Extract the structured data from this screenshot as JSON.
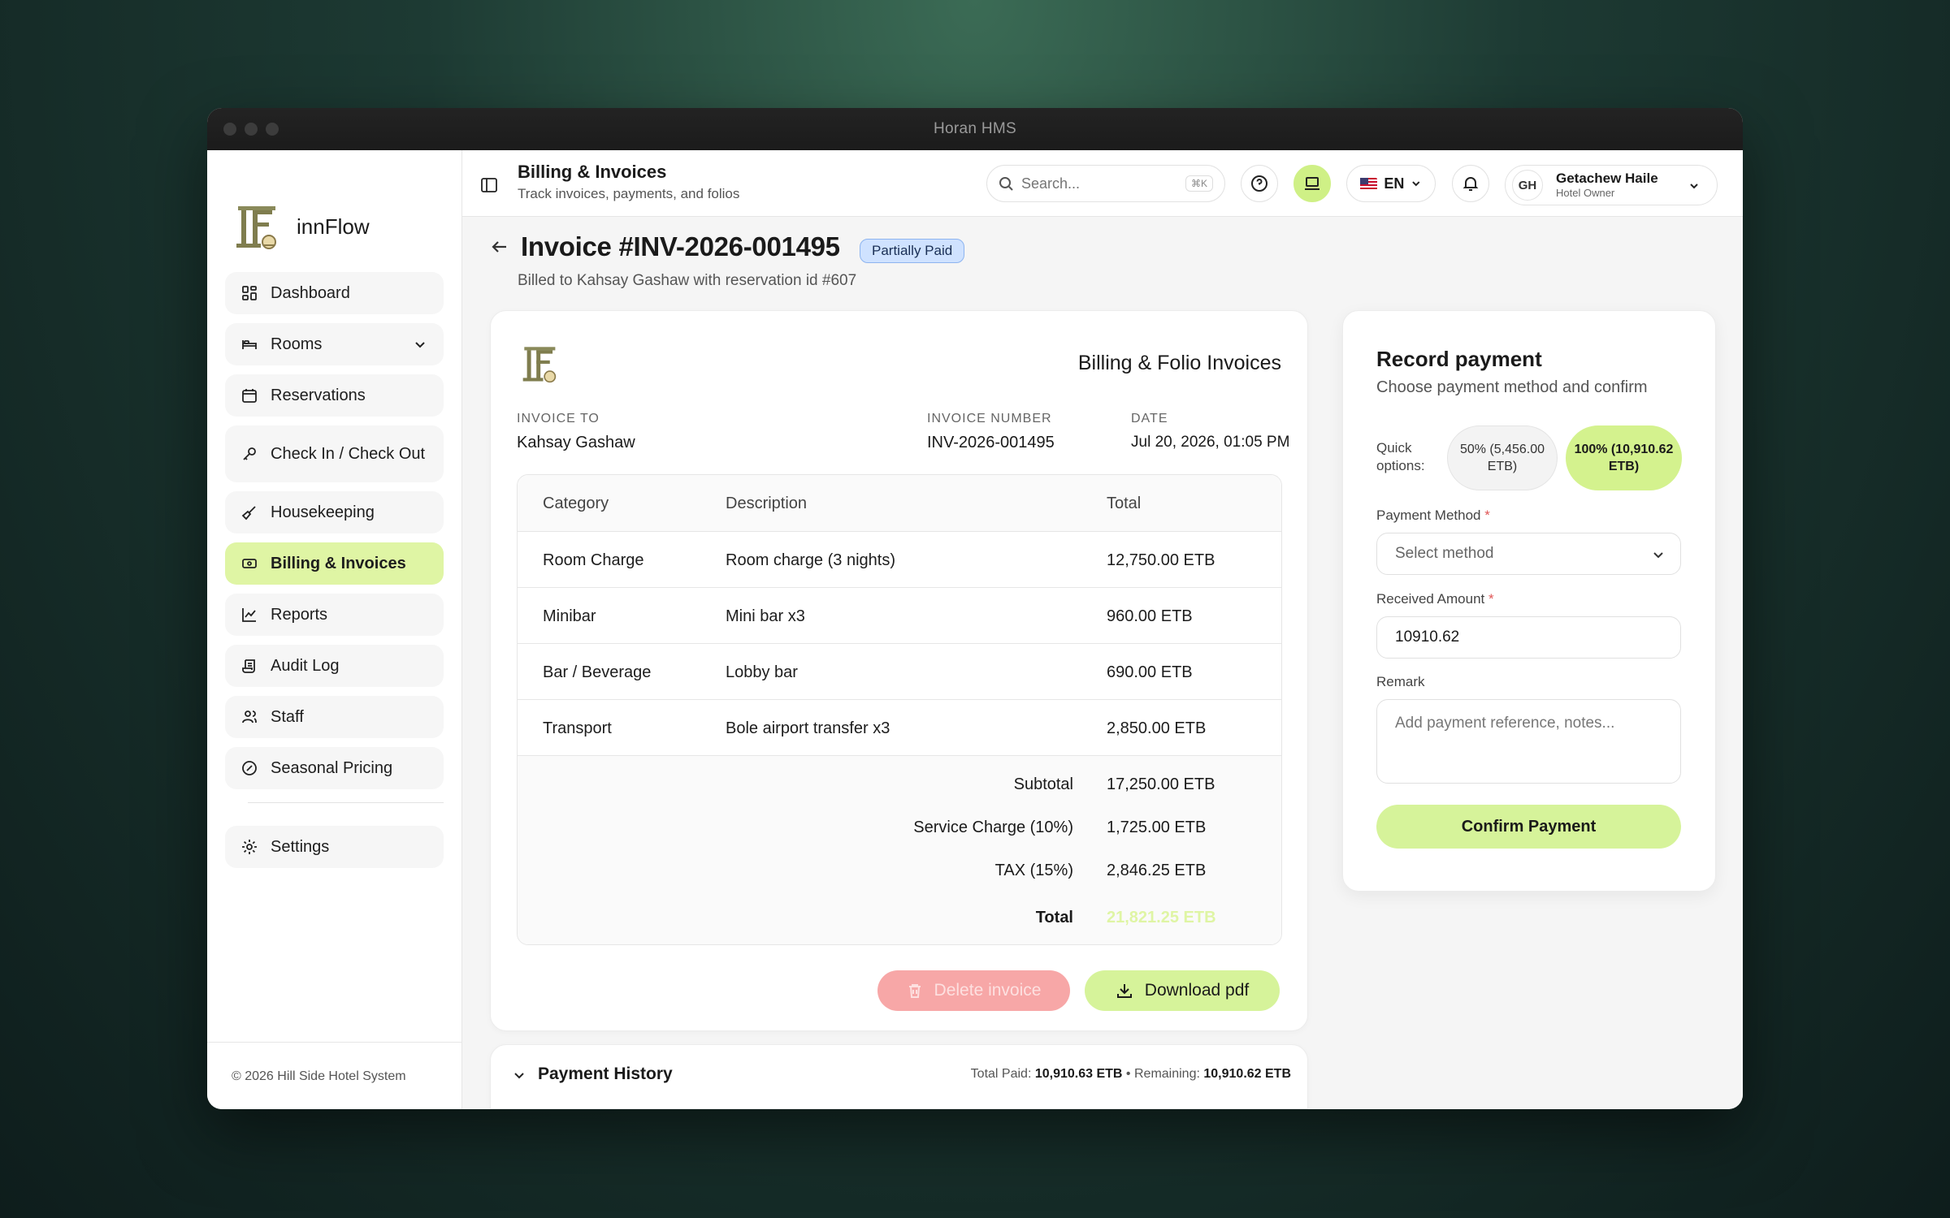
{
  "window": {
    "title": "Horan HMS"
  },
  "brand": {
    "name": "innFlow"
  },
  "sidebar": {
    "items": [
      {
        "label": "Dashboard",
        "icon": "dashboard-icon"
      },
      {
        "label": "Rooms",
        "icon": "bed-icon",
        "expandable": true
      },
      {
        "label": "Reservations",
        "icon": "calendar-icon"
      },
      {
        "label": "Check In / Check Out",
        "icon": "key-icon"
      },
      {
        "label": "Housekeeping",
        "icon": "broom-icon"
      },
      {
        "label": "Billing & Invoices",
        "icon": "banknote-icon",
        "active": true
      },
      {
        "label": "Reports",
        "icon": "chart-line-icon"
      },
      {
        "label": "Audit Log",
        "icon": "scroll-icon"
      },
      {
        "label": "Staff",
        "icon": "users-icon"
      },
      {
        "label": "Seasonal Pricing",
        "icon": "pricing-icon"
      }
    ],
    "settings_label": "Settings",
    "copyright": "© 2026 Hill Side Hotel System"
  },
  "header": {
    "title": "Billing & Invoices",
    "subtitle": "Track invoices, payments, and folios",
    "search_placeholder": "Search...",
    "search_shortcut": "⌘K",
    "language": "EN",
    "user": {
      "initials": "GH",
      "name": "Getachew Haile",
      "role": "Hotel Owner"
    }
  },
  "invoice": {
    "title": "Invoice #INV-2026-001495",
    "status": "Partially Paid",
    "billed_to": "Billed to Kahsay Gashaw with reservation id #607",
    "card_heading": "Billing & Folio Invoices",
    "invoice_to_label": "INVOICE TO",
    "invoice_to": "Kahsay Gashaw",
    "number_label": "INVOICE NUMBER",
    "number": "INV-2026-001495",
    "date_label": "DATE",
    "date": "Jul 20, 2026, 01:05 PM",
    "columns": {
      "category": "Category",
      "description": "Description",
      "total": "Total"
    },
    "rows": [
      {
        "category": "Room Charge",
        "description": "Room charge (3 nights)",
        "total": "12,750.00 ETB"
      },
      {
        "category": "Minibar",
        "description": "Mini bar x3",
        "total": "960.00 ETB"
      },
      {
        "category": "Bar / Beverage",
        "description": "Lobby bar",
        "total": "690.00 ETB"
      },
      {
        "category": "Transport",
        "description": "Bole airport transfer x3",
        "total": "2,850.00 ETB"
      }
    ],
    "totals": [
      {
        "label": "Subtotal",
        "value": "17,250.00 ETB"
      },
      {
        "label": "Service Charge (10%)",
        "value": "1,725.00 ETB"
      },
      {
        "label": "TAX (15%)",
        "value": "2,846.25 ETB"
      },
      {
        "label": "Total",
        "value": "21,821.25 ETB"
      }
    ],
    "delete_label": "Delete invoice",
    "download_label": "Download pdf"
  },
  "history": {
    "title": "Payment History",
    "paid_label": "Total Paid:",
    "paid_value": "10,910.63 ETB",
    "separator": "•",
    "remaining_label": "Remaining:",
    "remaining_value": "10,910.62 ETB"
  },
  "payment": {
    "title": "Record payment",
    "subtitle": "Choose payment method and confirm",
    "quick_label": "Quick options:",
    "quick_50": "50% (5,456.00 ETB)",
    "quick_100": "100% (10,910.62 ETB)",
    "method_label": "Payment Method",
    "method_placeholder": "Select method",
    "amount_label": "Received Amount",
    "amount_value": "10910.62",
    "remark_label": "Remark",
    "remark_placeholder": "Add payment reference, notes...",
    "required_mark": "*",
    "confirm_label": "Confirm Payment"
  },
  "colors": {
    "accent": "#d6f39a",
    "active_nav": "#dff5a4",
    "danger": "#f7a7a7",
    "badge": "#cfe2ff"
  }
}
